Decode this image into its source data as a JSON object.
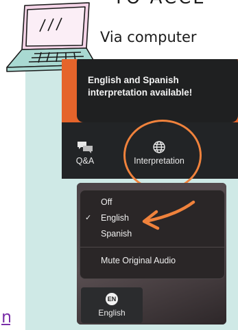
{
  "header": {
    "title": "TO ACCE",
    "subtitle": "Via computer"
  },
  "link_fragment": "n",
  "zoom_toolbar": {
    "tooltip": "English and Spanish interpretation available!",
    "qa_label": "Q&A",
    "interpretation_label": "Interpretation"
  },
  "language_menu": {
    "items": [
      {
        "label": "Off",
        "checked": false
      },
      {
        "label": "English",
        "checked": true
      },
      {
        "label": "Spanish",
        "checked": false
      },
      {
        "label": "Mute Original Audio",
        "checked": false
      }
    ],
    "check_glyph": "✓"
  },
  "language_button": {
    "badge": "EN",
    "label": "English"
  },
  "colors": {
    "accent_orange": "#f0823c",
    "teal": "#cfe9e6",
    "laptop_screen": "#f5d5e8",
    "laptop_base": "#a9d9d2"
  }
}
